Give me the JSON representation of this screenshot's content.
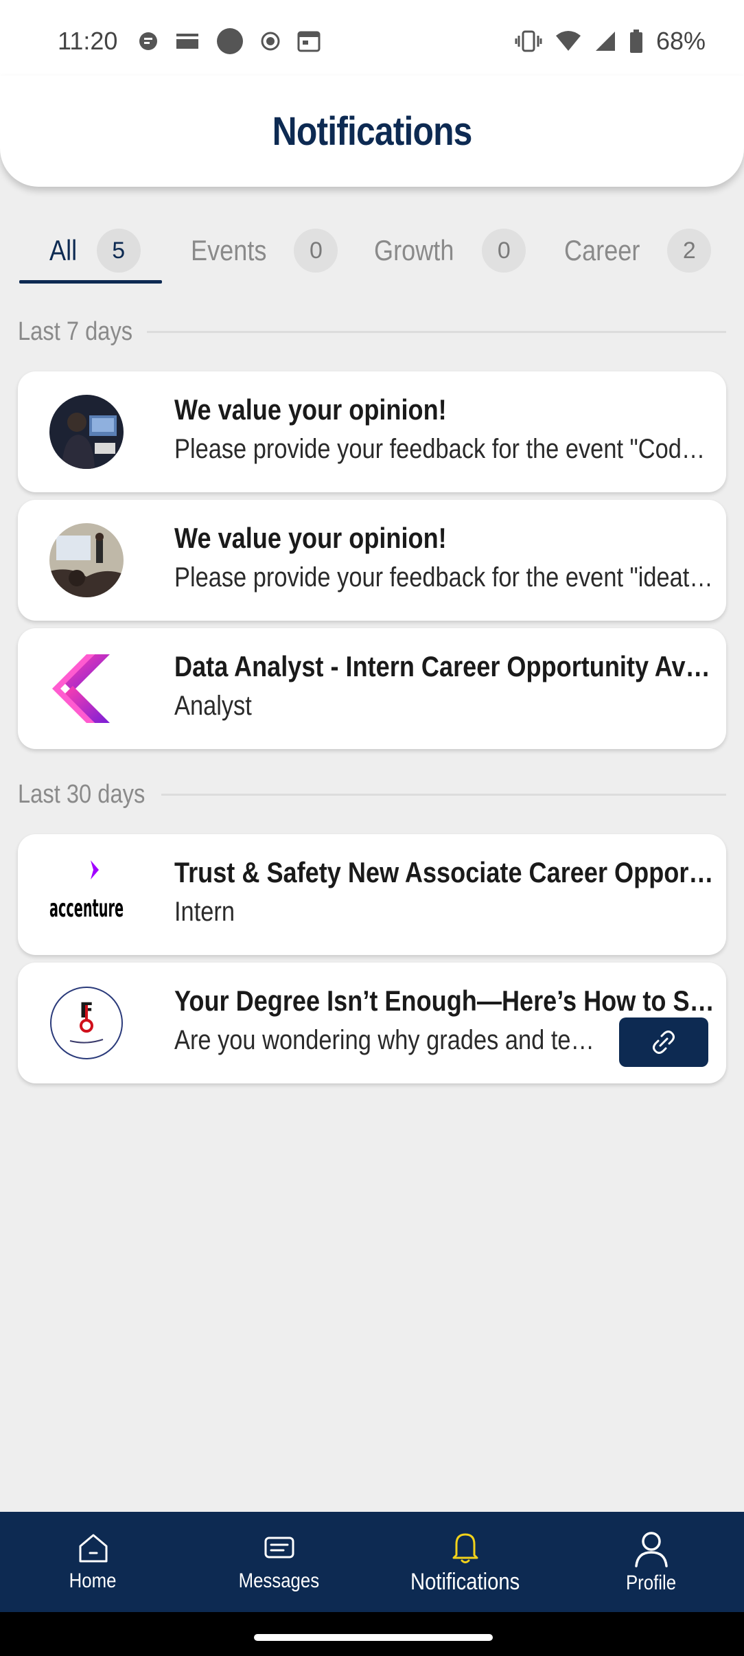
{
  "status_bar": {
    "time": "11:20",
    "battery": "68%"
  },
  "header": {
    "title": "Notifications"
  },
  "tabs": [
    {
      "label": "All",
      "count": "5"
    },
    {
      "label": "Events",
      "count": "0"
    },
    {
      "label": "Growth",
      "count": "0"
    },
    {
      "label": "Career",
      "count": "2"
    }
  ],
  "sections": [
    {
      "label": "Last 7 days",
      "items": [
        {
          "title": "We value your opinion!",
          "subtitle": "Please provide your feedback for the event \"Code-a-thon\""
        },
        {
          "title": "We value your opinion!",
          "subtitle": "Please provide your feedback for the event \"ideathon\" ..."
        },
        {
          "title": "Data Analyst - Intern Career Opportunity Available",
          "subtitle": "Analyst"
        }
      ]
    },
    {
      "label": "Last 30 days",
      "items": [
        {
          "title": "Trust & Safety New Associate Career Opportunity",
          "subtitle": "Intern"
        },
        {
          "title": "Your Degree Isn’t Enough—Here’s How to Stand Out",
          "subtitle": "Are you wondering why grades and technical skills"
        }
      ]
    }
  ],
  "avatars": {
    "accenture_text": "accenture"
  },
  "bottom_nav": [
    {
      "label": "Home",
      "icon": "home-icon"
    },
    {
      "label": "Messages",
      "icon": "messages-icon"
    },
    {
      "label": "Notifications",
      "icon": "bell-icon"
    },
    {
      "label": "Profile",
      "icon": "profile-icon"
    }
  ],
  "colors": {
    "primary": "#0d2a52",
    "active_nav_icon": "#f2d21b",
    "background": "#eeeeee"
  }
}
